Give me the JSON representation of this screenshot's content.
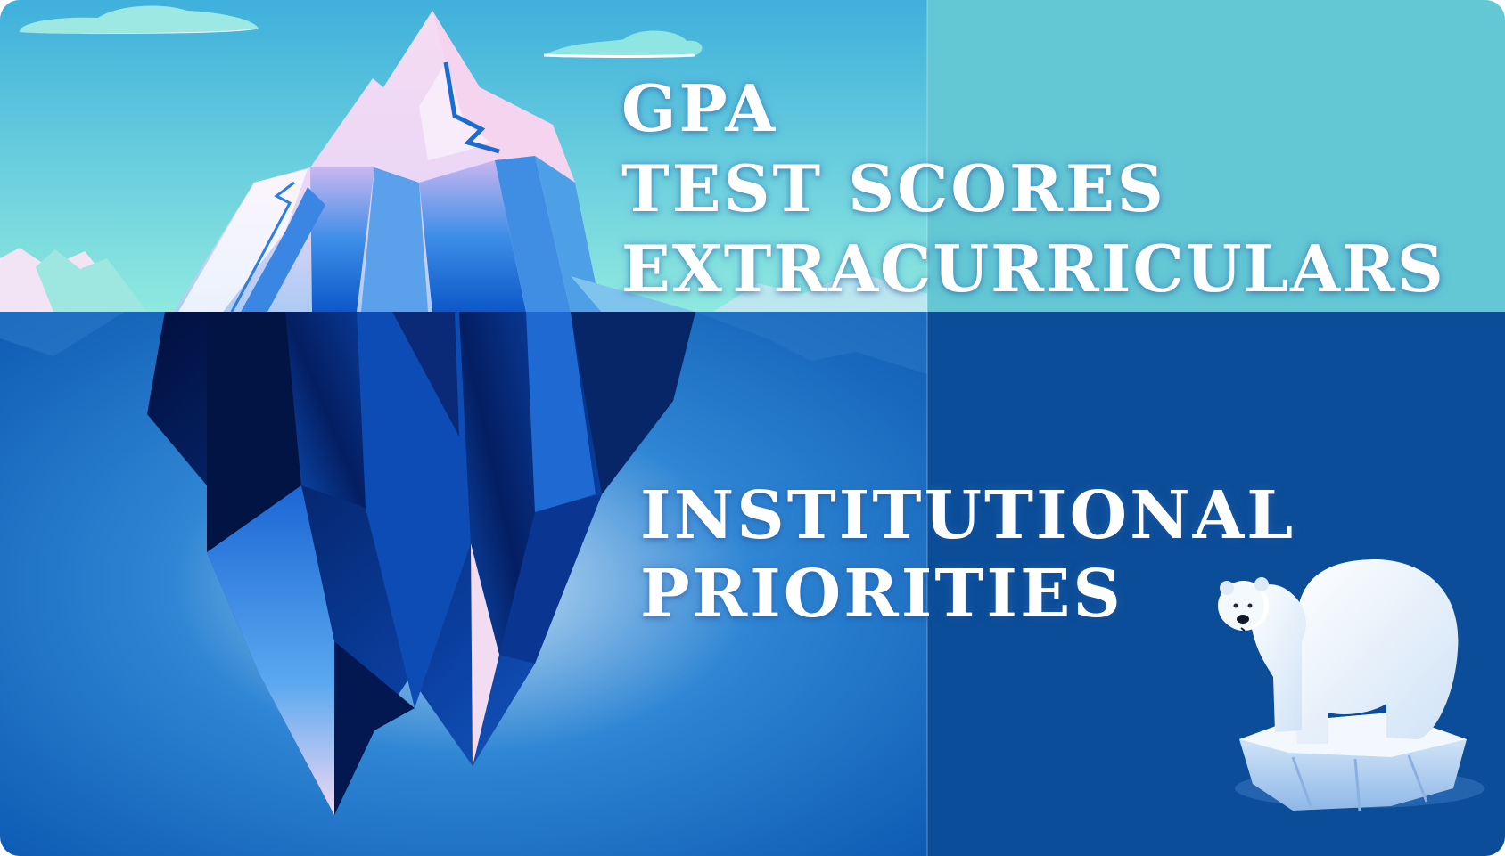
{
  "above_water": {
    "lines": [
      "GPA",
      "TEST SCORES",
      "EXTRACURRICULARS"
    ]
  },
  "below_water": {
    "lines": [
      "INSTITUTIONAL",
      "PRIORITIES"
    ]
  },
  "colors": {
    "sky_top": "#46b4dc",
    "sky_bottom": "#8be8e0",
    "sky_right_panel": "#63c7d4",
    "water_left": "#1a6cc4",
    "water_right_panel": "#0b4d98",
    "iceberg_peak": "#f4d8f0",
    "iceberg_deep": "#021a52",
    "text": "#ffffff"
  },
  "icons": [
    "iceberg-illustration",
    "polar-bear-on-ice-floe-illustration",
    "cloud-icon"
  ]
}
